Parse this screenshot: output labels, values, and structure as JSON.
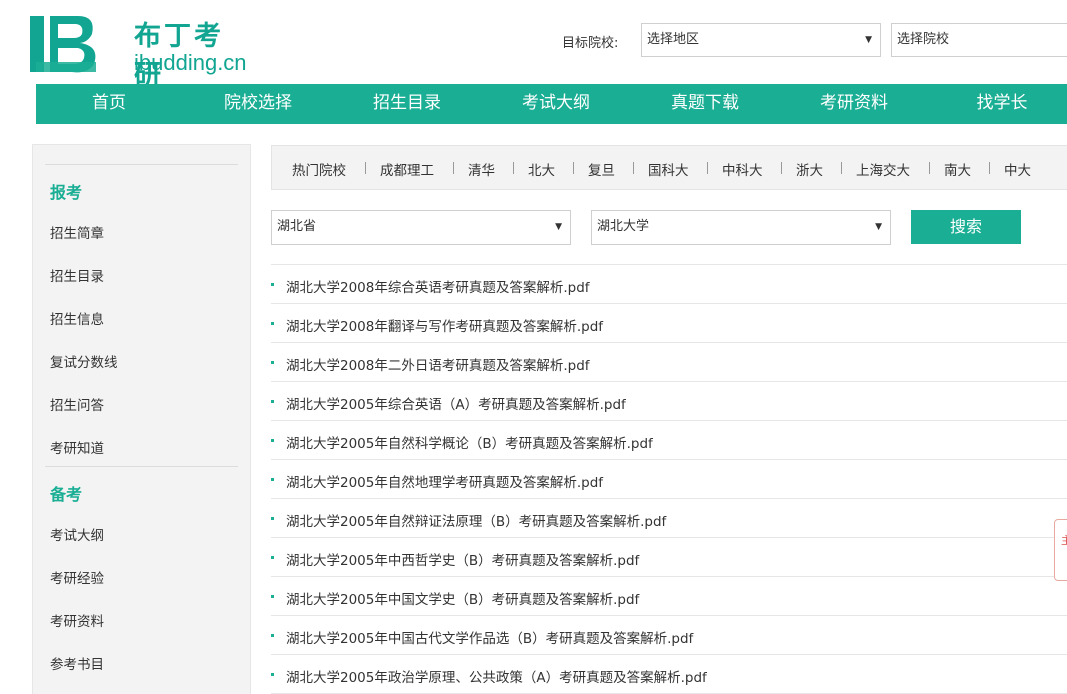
{
  "brand": {
    "name_cn": "布丁考研",
    "domain": "ibudding.cn"
  },
  "header": {
    "target_label": "目标院校:",
    "region_select": "选择地区",
    "school_select": "选择院校"
  },
  "nav": [
    "首页",
    "院校选择",
    "招生目录",
    "考试大纲",
    "真题下载",
    "考研资料",
    "找学长"
  ],
  "sidebar": {
    "section1": {
      "title": "报考",
      "items": [
        "招生简章",
        "招生目录",
        "招生信息",
        "复试分数线",
        "招生问答",
        "考研知道"
      ]
    },
    "section2": {
      "title": "备考",
      "items": [
        "考试大纲",
        "考研经验",
        "考研资料",
        "参考书目"
      ]
    }
  },
  "hot_schools": [
    "热门院校",
    "成都理工",
    "清华",
    "北大",
    "复旦",
    "国科大",
    "中科大",
    "浙大",
    "上海交大",
    "南大",
    "中大"
  ],
  "filter": {
    "province": "湖北省",
    "university": "湖北大学",
    "search_label": "搜索"
  },
  "files": [
    "湖北大学2008年综合英语考研真题及答案解析.pdf",
    "湖北大学2008年翻译与写作考研真题及答案解析.pdf",
    "湖北大学2008年二外日语考研真题及答案解析.pdf",
    "湖北大学2005年综合英语（A）考研真题及答案解析.pdf",
    "湖北大学2005年自然科学概论（B）考研真题及答案解析.pdf",
    "湖北大学2005年自然地理学考研真题及答案解析.pdf",
    "湖北大学2005年自然辩证法原理（B）考研真题及答案解析.pdf",
    "湖北大学2005年中西哲学史（B）考研真题及答案解析.pdf",
    "湖北大学2005年中国文学史（B）考研真题及答案解析.pdf",
    "湖北大学2005年中国古代文学作品选（B）考研真题及答案解析.pdf",
    "湖北大学2005年政治学原理、公共政策（A）考研真题及答案解析.pdf"
  ],
  "float_tab_char": "主",
  "colors": {
    "brand": "#1aae94",
    "sidebar_bg": "#f3f3f3"
  }
}
